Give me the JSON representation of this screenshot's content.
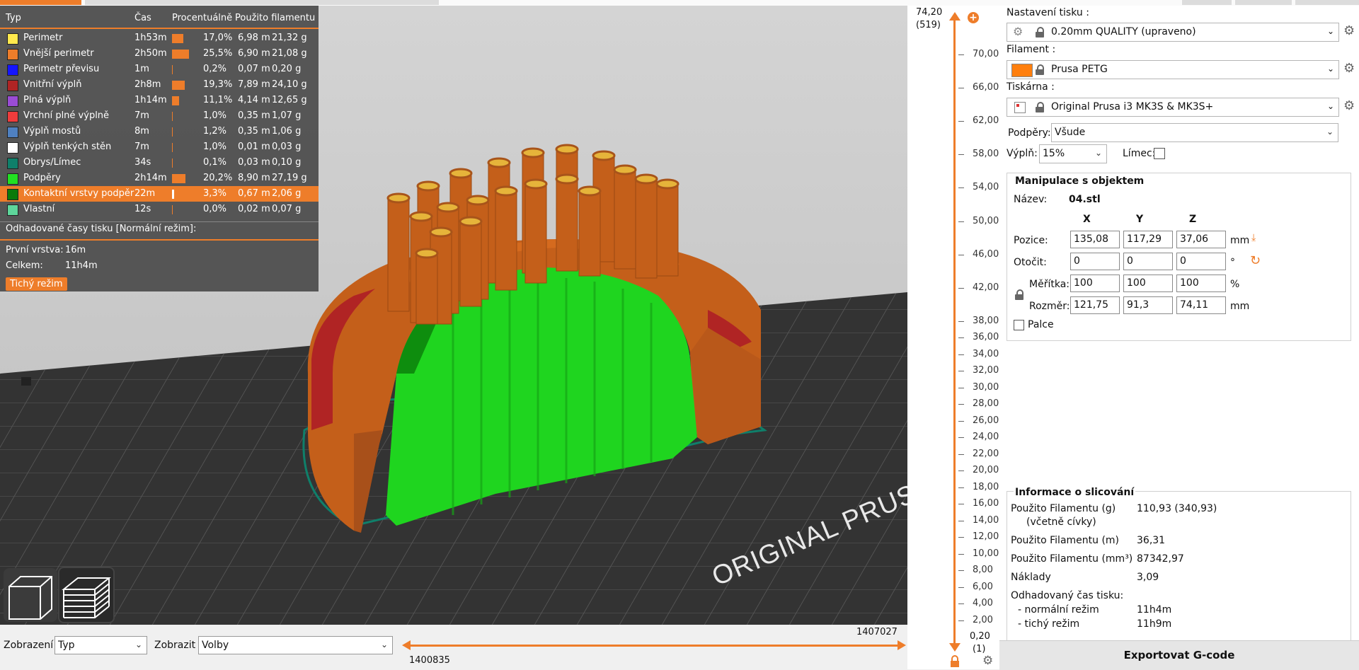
{
  "legend": {
    "headers": {
      "type": "Typ",
      "time": "Čas",
      "percent": "Procentuálně",
      "filament": "Použito filamentu"
    },
    "rows": [
      {
        "name": "Perimetr",
        "color": "#ffe94d",
        "time": "1h53m",
        "pct": 17.0,
        "pct_text": "17,0%",
        "len": "6,98 m",
        "wt": "21,32 g"
      },
      {
        "name": "Vnější perimetr",
        "color": "#ee7d2a",
        "time": "2h50m",
        "pct": 25.5,
        "pct_text": "25,5%",
        "len": "6,90 m",
        "wt": "21,08 g"
      },
      {
        "name": "Perimetr převisu",
        "color": "#1515ff",
        "time": "1m",
        "pct": 0.2,
        "pct_text": "0,2%",
        "len": "0,07 m",
        "wt": "0,20 g"
      },
      {
        "name": "Vnitřní výplň",
        "color": "#b02424",
        "time": "2h8m",
        "pct": 19.3,
        "pct_text": "19,3%",
        "len": "7,89 m",
        "wt": "24,10 g"
      },
      {
        "name": "Plná výplň",
        "color": "#9a4cd5",
        "time": "1h14m",
        "pct": 11.1,
        "pct_text": "11,1%",
        "len": "4,14 m",
        "wt": "12,65 g"
      },
      {
        "name": "Vrchní plné výplně",
        "color": "#f03c3c",
        "time": "7m",
        "pct": 1.0,
        "pct_text": "1,0%",
        "len": "0,35 m",
        "wt": "1,07 g"
      },
      {
        "name": "Výplň mostů",
        "color": "#4f80c0",
        "time": "8m",
        "pct": 1.2,
        "pct_text": "1,2%",
        "len": "0,35 m",
        "wt": "1,06 g"
      },
      {
        "name": "Výplň tenkých stěn",
        "color": "#ffffff",
        "time": "7m",
        "pct": 1.0,
        "pct_text": "1,0%",
        "len": "0,01 m",
        "wt": "0,03 g"
      },
      {
        "name": "Obrys/Límec",
        "color": "#0f7f6a",
        "time": "34s",
        "pct": 0.1,
        "pct_text": "0,1%",
        "len": "0,03 m",
        "wt": "0,10 g"
      },
      {
        "name": "Podpěry",
        "color": "#22e022",
        "time": "2h14m",
        "pct": 20.2,
        "pct_text": "20,2%",
        "len": "8,90 m",
        "wt": "27,19 g"
      },
      {
        "name": "Kontaktní vrstvy podpěr",
        "color": "#0a7a0a",
        "time": "22m",
        "pct": 3.3,
        "pct_text": "3,3%",
        "len": "0,67 m",
        "wt": "2,06 g",
        "highlight": true
      },
      {
        "name": "Vlastní",
        "color": "#5ed69b",
        "time": "12s",
        "pct": 0.0,
        "pct_text": "0,0%",
        "len": "0,02 m",
        "wt": "0,07 g"
      }
    ],
    "est_title": "Odhadované časy tisku [Normální režim]:",
    "first_layer_label": "První vrstva:",
    "first_layer_value": "16m",
    "total_label": "Celkem:",
    "total_value": "11h4m",
    "quiet_button": "Tichý režim"
  },
  "viewport": {
    "bed_text": "ORIGINAL PRUSA"
  },
  "bottom": {
    "view_label": "Zobrazení",
    "view_value": "Typ",
    "show_label": "Zobrazit",
    "show_value": "Volby",
    "hslider_right": "1407027",
    "hslider_left": "1400835"
  },
  "vslider": {
    "top_value": "74,20",
    "top_layer": "(519)",
    "bottom_value": "0,20",
    "bottom_layer": "(1)",
    "ticks": [
      "70,00",
      "66,00",
      "62,00",
      "58,00",
      "54,00",
      "50,00",
      "46,00",
      "42,00",
      "38,00",
      "36,00",
      "34,00",
      "32,00",
      "30,00",
      "28,00",
      "26,00",
      "24,00",
      "22,00",
      "20,00",
      "18,00",
      "16,00",
      "14,00",
      "12,00",
      "10,00",
      "8,00",
      "6,00",
      "4,00",
      "2,00"
    ]
  },
  "panel": {
    "print_settings_label": "Nastavení tisku :",
    "print_settings_value": "0.20mm QUALITY (upraveno)",
    "filament_label": "Filament :",
    "filament_value": "Prusa PETG",
    "filament_color": "#ff7f0e",
    "printer_label": "Tiskárna :",
    "printer_value": "Original Prusa i3 MK3S & MK3S+",
    "supports_label": "Podpěry:",
    "supports_value": "Všude",
    "infill_label": "Výplň:",
    "infill_value": "15%",
    "brim_label": "Límec:",
    "manip": {
      "title": "Manipulace s objektem",
      "name_label": "Název:",
      "name_value": "04.stl",
      "col_x": "X",
      "col_y": "Y",
      "col_z": "Z",
      "pos_label": "Pozice:",
      "pos": [
        "135,08",
        "117,29",
        "37,06"
      ],
      "pos_unit": "mm",
      "rot_label": "Otočit:",
      "rot": [
        "0",
        "0",
        "0"
      ],
      "rot_unit": "°",
      "scale_label": "Měřítka:",
      "scale": [
        "100",
        "100",
        "100"
      ],
      "scale_unit": "%",
      "size_label": "Rozměr:",
      "size": [
        "121,75",
        "91,3",
        "74,11"
      ],
      "size_unit": "mm",
      "inches_label": "Palce"
    },
    "slice": {
      "title": "Informace o slicování",
      "fil_g_label": "Použito Filamentu (g)",
      "fil_g_sub": "(včetně cívky)",
      "fil_g_value": "110,93 (340,93)",
      "fil_m_label": "Použito Filamentu (m)",
      "fil_m_value": "36,31",
      "fil_mm3_label": "Použito Filamentu (mm³)",
      "fil_mm3_value": "87342,97",
      "cost_label": "Náklady",
      "cost_value": "3,09",
      "est_label": "Odhadovaný čas tisku:",
      "normal_label": "- normální režim",
      "normal_value": "11h4m",
      "quiet_label": "- tichý režim",
      "quiet_value": "11h9m"
    },
    "export_button": "Exportovat G-code"
  }
}
